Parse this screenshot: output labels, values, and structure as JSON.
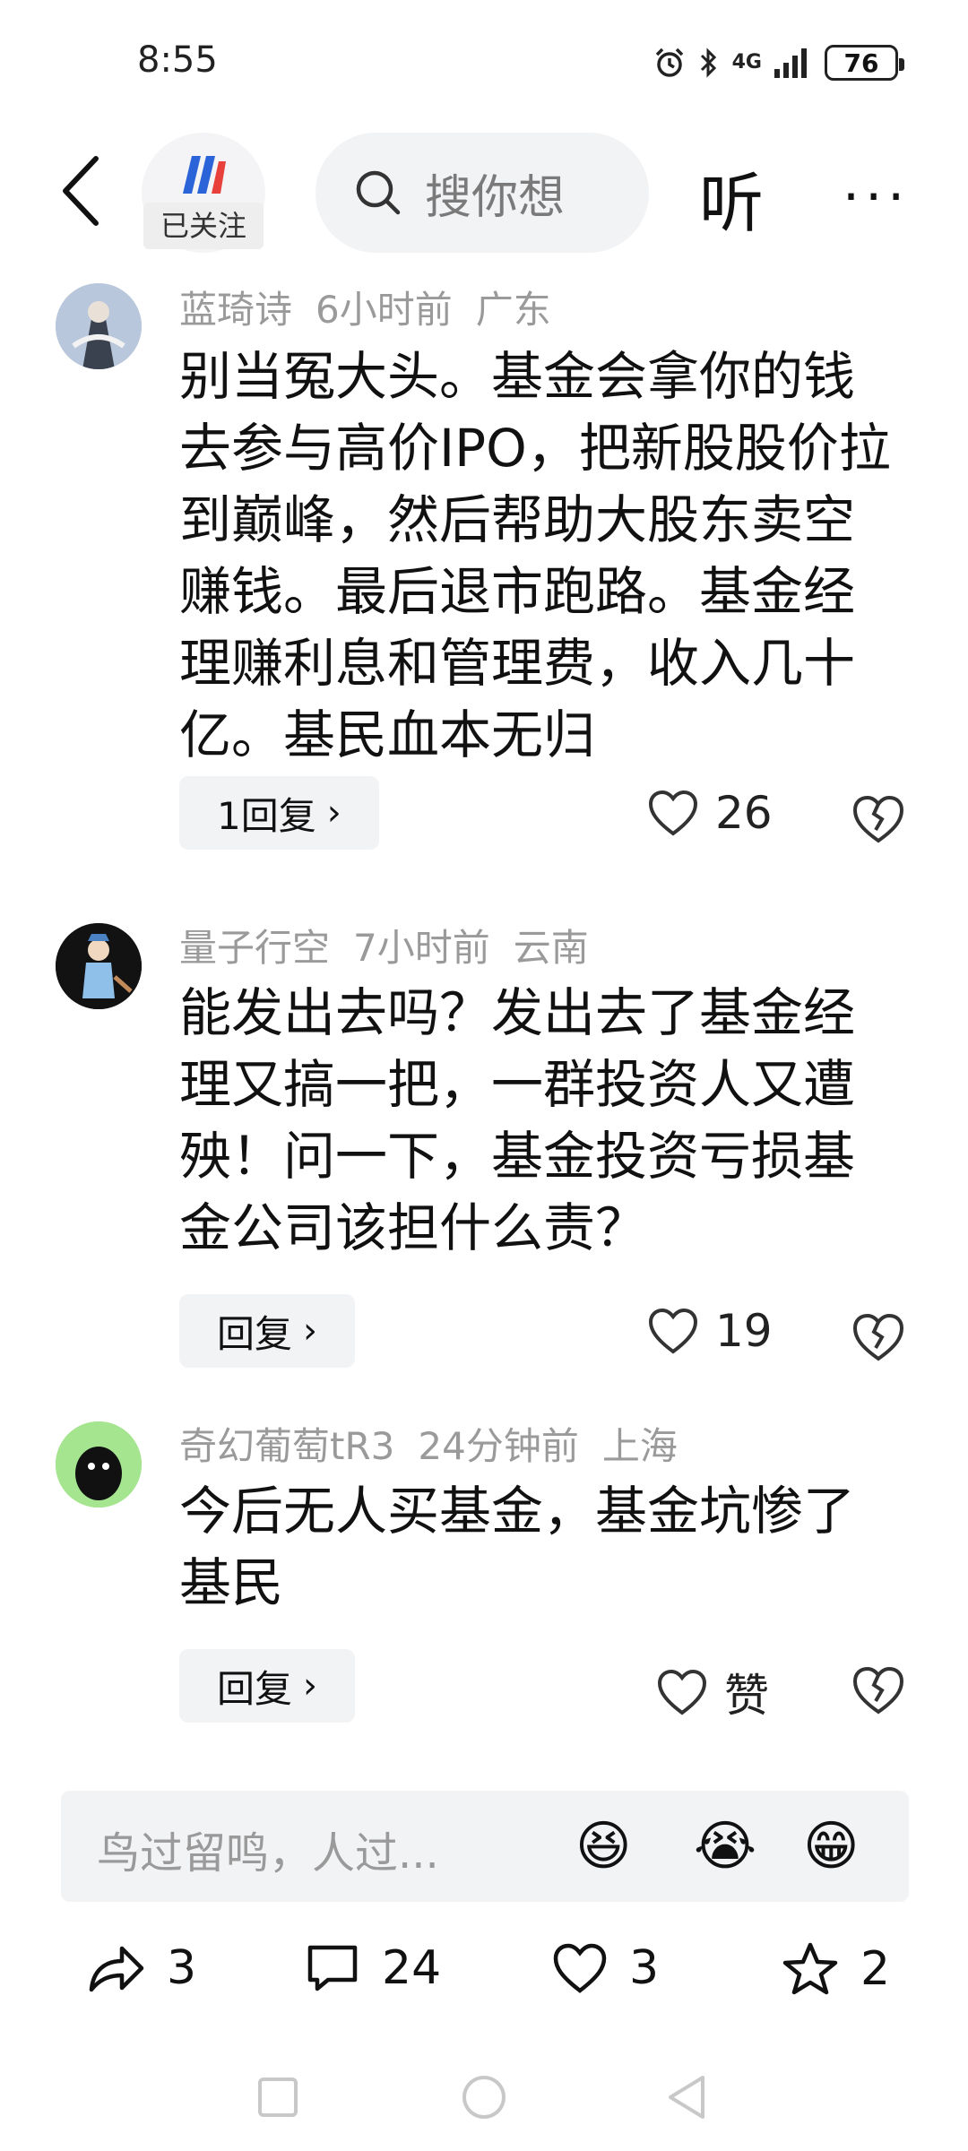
{
  "status_bar": {
    "time": "8:55",
    "network": "4G",
    "battery": "76",
    "icons": [
      "alarm-icon",
      "bluetooth-icon",
      "signal-icon",
      "battery-icon"
    ]
  },
  "nav": {
    "follow_label": "已关注",
    "search_placeholder": "搜你想",
    "listen_label": "听",
    "more_label": "···"
  },
  "comments": [
    {
      "user": "蓝琦诗",
      "time": "6小时前",
      "location": "广东",
      "text": "别当冤大头。基金会拿你的钱去参与高价IPO，把新股股价拉到巅峰，然后帮助大股东卖空赚钱。最后退市跑路。基金经理赚利息和管理费，收入几十亿。基民血本无归",
      "reply_label": "1回复",
      "likes": "26"
    },
    {
      "user": "量子行空",
      "time": "7小时前",
      "location": "云南",
      "text": "能发出去吗？发出去了基金经理又搞一把，一群投资人又遭殃！问一下，基金投资亏损基金公司该担什么责？",
      "reply_label": "回复",
      "likes": "19"
    },
    {
      "user": "奇幻葡萄tR3",
      "time": "24分钟前",
      "location": "上海",
      "text": "今后无人买基金，基金坑惨了基民",
      "reply_label": "回复",
      "likes": "赞"
    }
  ],
  "input": {
    "placeholder": "鸟过留鸣，人过...",
    "emojis": [
      "😆",
      "😭",
      "😁"
    ]
  },
  "actions": {
    "share_count": "3",
    "comment_count": "24",
    "like_count": "3",
    "favorite_count": "2"
  },
  "colors": {
    "logo_blue": "#2b63d9",
    "logo_red": "#e8413b",
    "pill_bg": "#f2f3f5",
    "meta_gray": "#9a9a9a"
  }
}
